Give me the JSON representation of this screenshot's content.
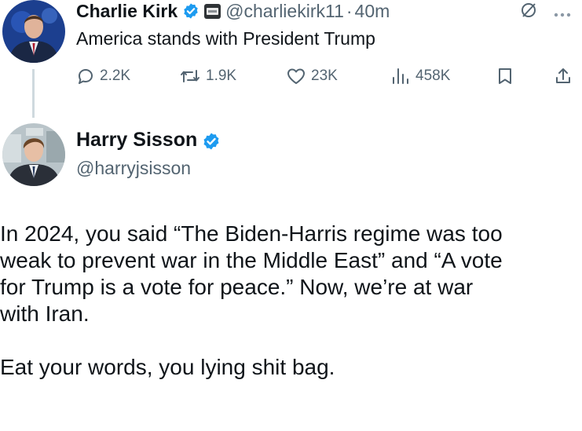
{
  "original_tweet": {
    "author_name": "Charlie Kirk",
    "handle": "@charliekirk11",
    "separator": "·",
    "time": "40m",
    "text": "America stands with President Trump",
    "stats": {
      "replies": "2.2K",
      "reposts": "1.9K",
      "likes": "23K",
      "views": "458K"
    }
  },
  "reply_tweet": {
    "author_name": "Harry Sisson",
    "handle": "@harryjsisson",
    "text_lines": [
      "In 2024, you said “The Biden-Harris regime was too",
      "weak to prevent war in the Middle East” and “A vote",
      "for Trump is a vote for peace.” Now, we’re at war",
      "with Iran."
    ],
    "text_line_2": "Eat your words, you lying shit bag."
  },
  "colors": {
    "verified_blue": "#1d9bf0",
    "muted_text": "#536471",
    "main_text": "#0f1419",
    "thread_line": "#cfd9de"
  },
  "icons": [
    "verified-badge-icon",
    "affiliate-badge-icon",
    "grok-icon",
    "more-icon",
    "reply-icon",
    "repost-icon",
    "like-icon",
    "views-icon",
    "bookmark-icon",
    "share-icon"
  ]
}
